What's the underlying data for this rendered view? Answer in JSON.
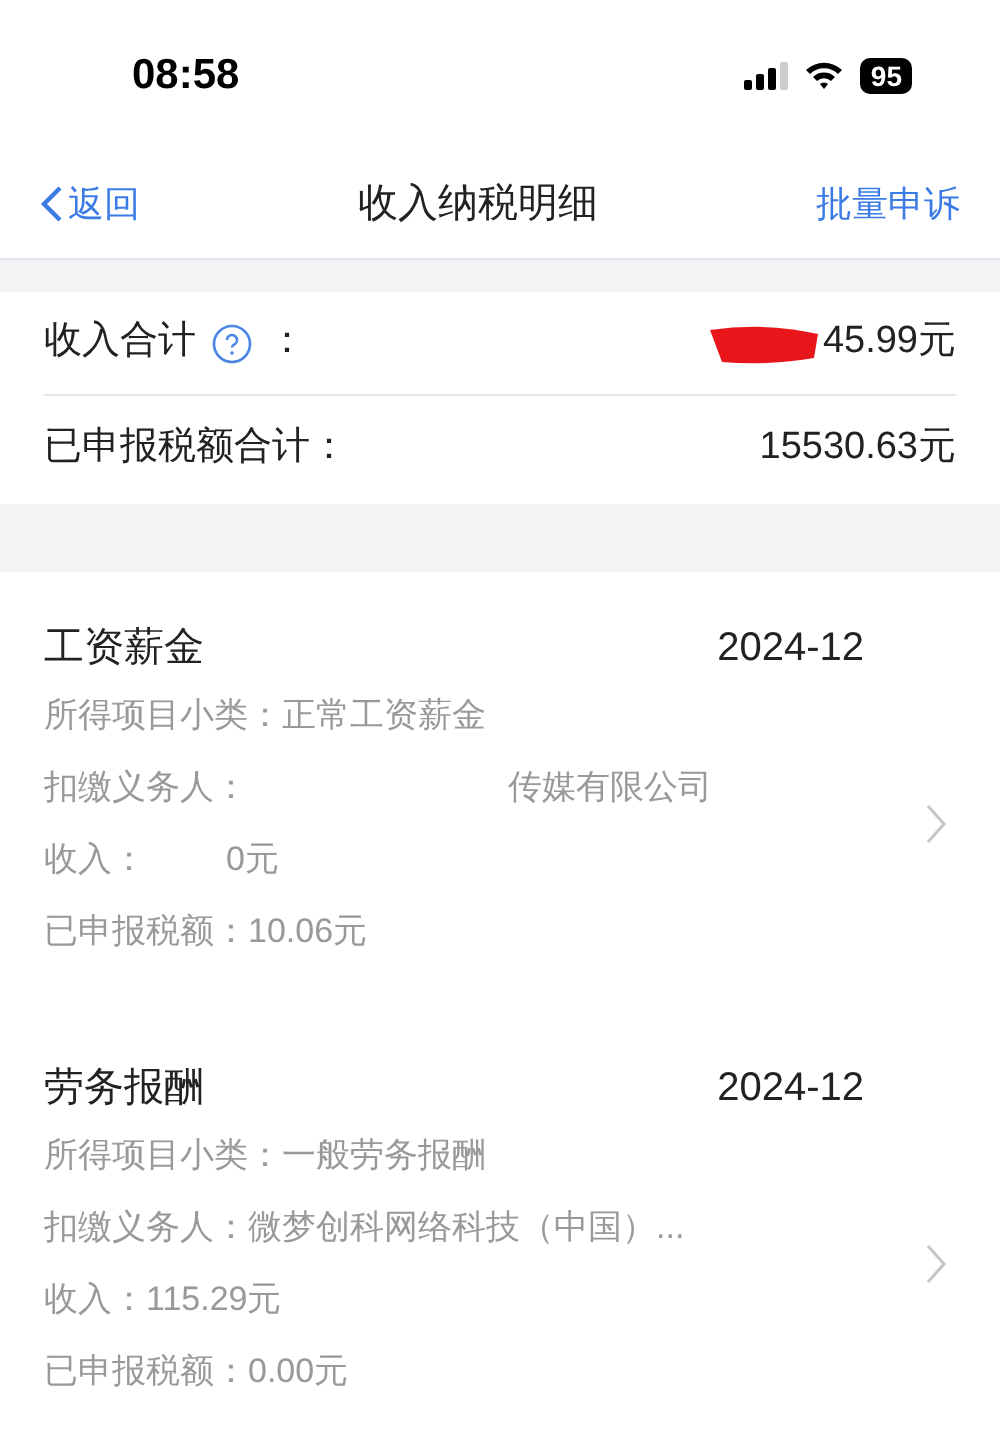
{
  "status_bar": {
    "time": "08:58",
    "battery": "95"
  },
  "nav": {
    "back": "返回",
    "title": "收入纳税明细",
    "action": "批量申诉"
  },
  "summary": [
    {
      "label": "收入合计",
      "help": true,
      "colon": "：",
      "value": "45.99元",
      "redacted": true
    },
    {
      "label": "已申报税额合计：",
      "help": false,
      "value": "15530.63元",
      "redacted": false
    }
  ],
  "records": [
    {
      "category": "工资薪金",
      "period": "2024-12",
      "rows": [
        {
          "label": "所得项目小类：",
          "value": "正常工资薪金",
          "gap": false
        },
        {
          "label": "扣缴义务人：",
          "value": "传媒有限公司",
          "gap": true
        },
        {
          "label": "收入：",
          "value": "0元",
          "gap": true
        },
        {
          "label": "已申报税额：",
          "value": "10.06元",
          "gap": false
        }
      ]
    },
    {
      "category": "劳务报酬",
      "period": "2024-12",
      "rows": [
        {
          "label": "所得项目小类：",
          "value": "一般劳务报酬",
          "gap": false
        },
        {
          "label": "扣缴义务人：",
          "value": "微梦创科网络科技（中国）...",
          "gap": false
        },
        {
          "label": "收入：",
          "value": "115.29元",
          "gap": false
        },
        {
          "label": "已申报税额：",
          "value": "0.00元",
          "gap": false
        }
      ]
    }
  ]
}
